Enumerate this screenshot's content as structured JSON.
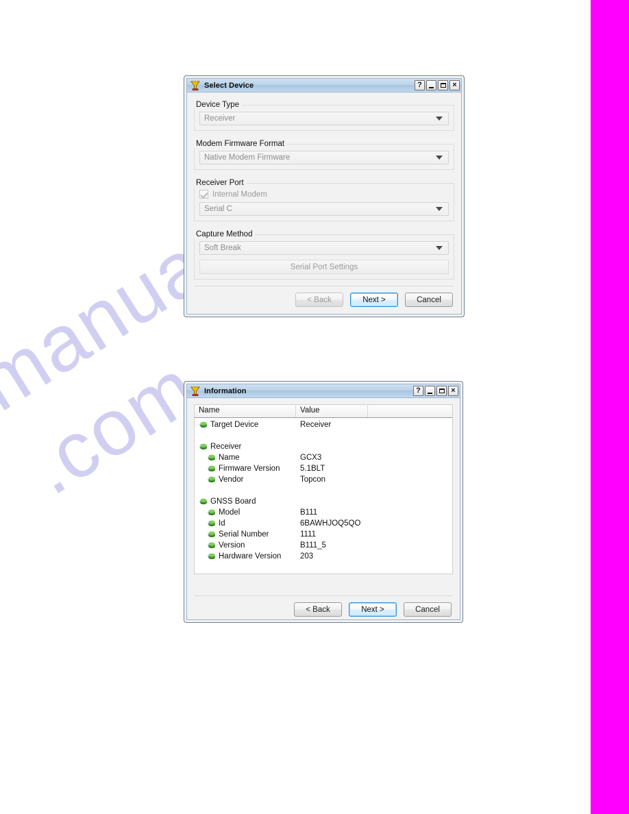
{
  "page": {
    "background_color": "#ffffff",
    "side_bar_color": "#ff00ff",
    "watermark_line1": "manualshive",
    "watermark_line2": ".com"
  },
  "select_device_dialog": {
    "title": "Select Device",
    "title_icon": "funnel-icon",
    "window_buttons": [
      {
        "name": "help-button",
        "label": "?"
      },
      {
        "name": "minimize-button",
        "label": "_"
      },
      {
        "name": "maximize-button",
        "label": "□"
      },
      {
        "name": "close-button",
        "label": "×"
      }
    ],
    "groups": {
      "device_type": {
        "label": "Device Type",
        "combo_value": "Receiver",
        "combo_options": [
          "Receiver"
        ]
      },
      "modem_firmware_format": {
        "label": "Modem Firmware Format",
        "combo_value": "Native Modem Firmware",
        "combo_options": [
          "Native Modem Firmware"
        ]
      },
      "receiver_port": {
        "label": "Receiver Port",
        "checkbox_label": "Internal Modem",
        "checkbox_checked": true,
        "checkbox_disabled": true,
        "combo_value": "Serial C",
        "combo_options": [
          "Serial C"
        ]
      },
      "capture_method": {
        "label": "Capture Method",
        "combo_value": "Soft Break",
        "combo_options": [
          "Soft Break"
        ],
        "settings_button_label": "Serial Port Settings"
      }
    },
    "footer": {
      "back_label": "< Back",
      "next_label": "Next >",
      "cancel_label": "Cancel"
    }
  },
  "information_dialog": {
    "title": "Information",
    "title_icon": "funnel-icon",
    "window_buttons": [
      {
        "name": "help-button",
        "label": "?"
      },
      {
        "name": "minimize-button",
        "label": "_"
      },
      {
        "name": "maximize-button",
        "label": "□"
      },
      {
        "name": "close-button",
        "label": "×"
      }
    ],
    "columns": [
      "Name",
      "Value",
      ""
    ],
    "rows": [
      {
        "indent": 0,
        "icon": "node-icon",
        "name": "Target Device",
        "value": "Receiver"
      },
      {
        "spacer": true
      },
      {
        "indent": 0,
        "icon": "node-icon",
        "name": "Receiver",
        "value": ""
      },
      {
        "indent": 1,
        "icon": "node-icon",
        "name": "Name",
        "value": "GCX3"
      },
      {
        "indent": 1,
        "icon": "node-icon",
        "name": "Firmware Version",
        "value": "5.1BLT"
      },
      {
        "indent": 1,
        "icon": "node-icon",
        "name": "Vendor",
        "value": "Topcon"
      },
      {
        "spacer": true
      },
      {
        "indent": 0,
        "icon": "node-icon",
        "name": "GNSS Board",
        "value": ""
      },
      {
        "indent": 1,
        "icon": "node-icon",
        "name": "Model",
        "value": "B111"
      },
      {
        "indent": 1,
        "icon": "node-icon",
        "name": "Id",
        "value": "6BAWHJOQ5QO"
      },
      {
        "indent": 1,
        "icon": "node-icon",
        "name": "Serial Number",
        "value": "1111"
      },
      {
        "indent": 1,
        "icon": "node-icon",
        "name": "Version",
        "value": "B111_5"
      },
      {
        "indent": 1,
        "icon": "node-icon",
        "name": "Hardware Version",
        "value": "203"
      }
    ],
    "footer": {
      "back_label": "< Back",
      "next_label": "Next >",
      "cancel_label": "Cancel"
    }
  }
}
